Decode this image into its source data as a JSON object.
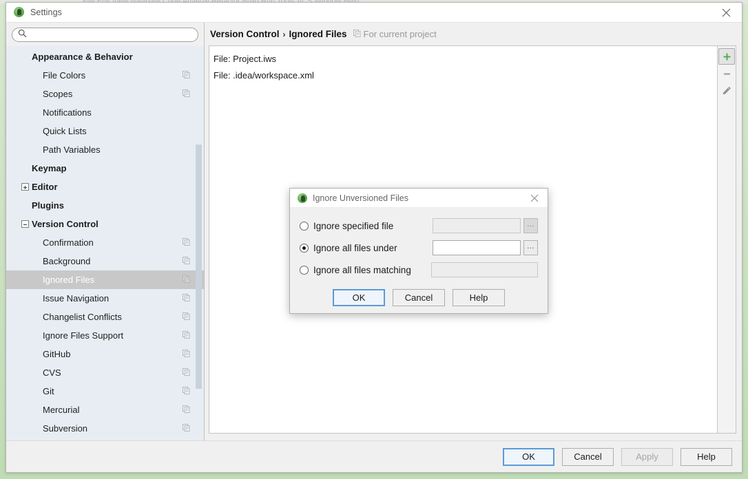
{
  "background": {
    "ghost_menu_text": "File   Edit   View   Navigate   Code   Analyze   Refactor   Build   Run   Tools   VCS   Window   Help",
    "page_bg_color": "#bfdcb4"
  },
  "window": {
    "title": "Settings",
    "app_icon": "intellij-logo-icon",
    "close_icon": "close-icon"
  },
  "search": {
    "value": "",
    "placeholder": "",
    "icon": "search-icon"
  },
  "sidebar": {
    "scrollbar": "vertical-scrollbar",
    "items": [
      {
        "label": "Appearance & Behavior",
        "level": "group",
        "expander": "none",
        "copy_icon": false,
        "selected": false
      },
      {
        "label": "File Colors",
        "level": "child",
        "expander": "none",
        "copy_icon": true,
        "selected": false
      },
      {
        "label": "Scopes",
        "level": "child",
        "expander": "none",
        "copy_icon": true,
        "selected": false
      },
      {
        "label": "Notifications",
        "level": "child",
        "expander": "none",
        "copy_icon": false,
        "selected": false
      },
      {
        "label": "Quick Lists",
        "level": "child",
        "expander": "none",
        "copy_icon": false,
        "selected": false
      },
      {
        "label": "Path Variables",
        "level": "child",
        "expander": "none",
        "copy_icon": false,
        "selected": false
      },
      {
        "label": "Keymap",
        "level": "group",
        "expander": "none",
        "copy_icon": false,
        "selected": false
      },
      {
        "label": "Editor",
        "level": "group",
        "expander": "plus",
        "copy_icon": false,
        "selected": false
      },
      {
        "label": "Plugins",
        "level": "group",
        "expander": "none",
        "copy_icon": false,
        "selected": false
      },
      {
        "label": "Version Control",
        "level": "group",
        "expander": "minus",
        "copy_icon": false,
        "selected": false
      },
      {
        "label": "Confirmation",
        "level": "child",
        "expander": "none",
        "copy_icon": true,
        "selected": false
      },
      {
        "label": "Background",
        "level": "child",
        "expander": "none",
        "copy_icon": true,
        "selected": false
      },
      {
        "label": "Ignored Files",
        "level": "child",
        "expander": "none",
        "copy_icon": true,
        "selected": true
      },
      {
        "label": "Issue Navigation",
        "level": "child",
        "expander": "none",
        "copy_icon": true,
        "selected": false
      },
      {
        "label": "Changelist Conflicts",
        "level": "child",
        "expander": "none",
        "copy_icon": true,
        "selected": false
      },
      {
        "label": "Ignore Files Support",
        "level": "child",
        "expander": "none",
        "copy_icon": true,
        "selected": false
      },
      {
        "label": "GitHub",
        "level": "child",
        "expander": "none",
        "copy_icon": true,
        "selected": false
      },
      {
        "label": "CVS",
        "level": "child",
        "expander": "none",
        "copy_icon": true,
        "selected": false
      },
      {
        "label": "Git",
        "level": "child",
        "expander": "none",
        "copy_icon": true,
        "selected": false
      },
      {
        "label": "Mercurial",
        "level": "child",
        "expander": "none",
        "copy_icon": true,
        "selected": false
      },
      {
        "label": "Subversion",
        "level": "child",
        "expander": "none",
        "copy_icon": true,
        "selected": false
      }
    ]
  },
  "breadcrumb": {
    "parent": "Version Control",
    "separator": "›",
    "current": "Ignored Files",
    "scope_icon": "copy-scope-icon",
    "scope_label": "For current project"
  },
  "ignored_files": {
    "entries": [
      "File: Project.iws",
      "File: .idea/workspace.xml"
    ]
  },
  "list_toolbar": {
    "buttons": [
      {
        "name": "add-button",
        "icon": "plus-icon",
        "state": "hovered",
        "color": "#4caf50"
      },
      {
        "name": "remove-button",
        "icon": "minus-icon",
        "state": "normal",
        "color": "#999999"
      },
      {
        "name": "edit-button",
        "icon": "pencil-icon",
        "state": "normal",
        "color": "#8a8a8a"
      }
    ]
  },
  "footer": {
    "buttons": [
      {
        "label": "OK",
        "style": "default"
      },
      {
        "label": "Cancel",
        "style": "normal"
      },
      {
        "label": "Apply",
        "style": "disabled"
      },
      {
        "label": "Help",
        "style": "normal"
      }
    ]
  },
  "dialog": {
    "title": "Ignore Unversioned Files",
    "app_icon": "intellij-logo-icon",
    "close_icon": "close-icon",
    "options": [
      {
        "label": "Ignore specified file",
        "selected": false,
        "field_value": "",
        "field_enabled": false,
        "has_browse": true,
        "browse_label": "…"
      },
      {
        "label": "Ignore all files under",
        "selected": true,
        "field_value": "",
        "field_enabled": true,
        "has_browse": true,
        "browse_label": "…"
      },
      {
        "label": "Ignore all files matching",
        "selected": false,
        "field_value": "",
        "field_enabled": false,
        "has_browse": false,
        "browse_label": ""
      }
    ],
    "buttons": [
      {
        "label": "OK",
        "style": "default"
      },
      {
        "label": "Cancel",
        "style": "normal"
      },
      {
        "label": "Help",
        "style": "normal"
      }
    ]
  }
}
